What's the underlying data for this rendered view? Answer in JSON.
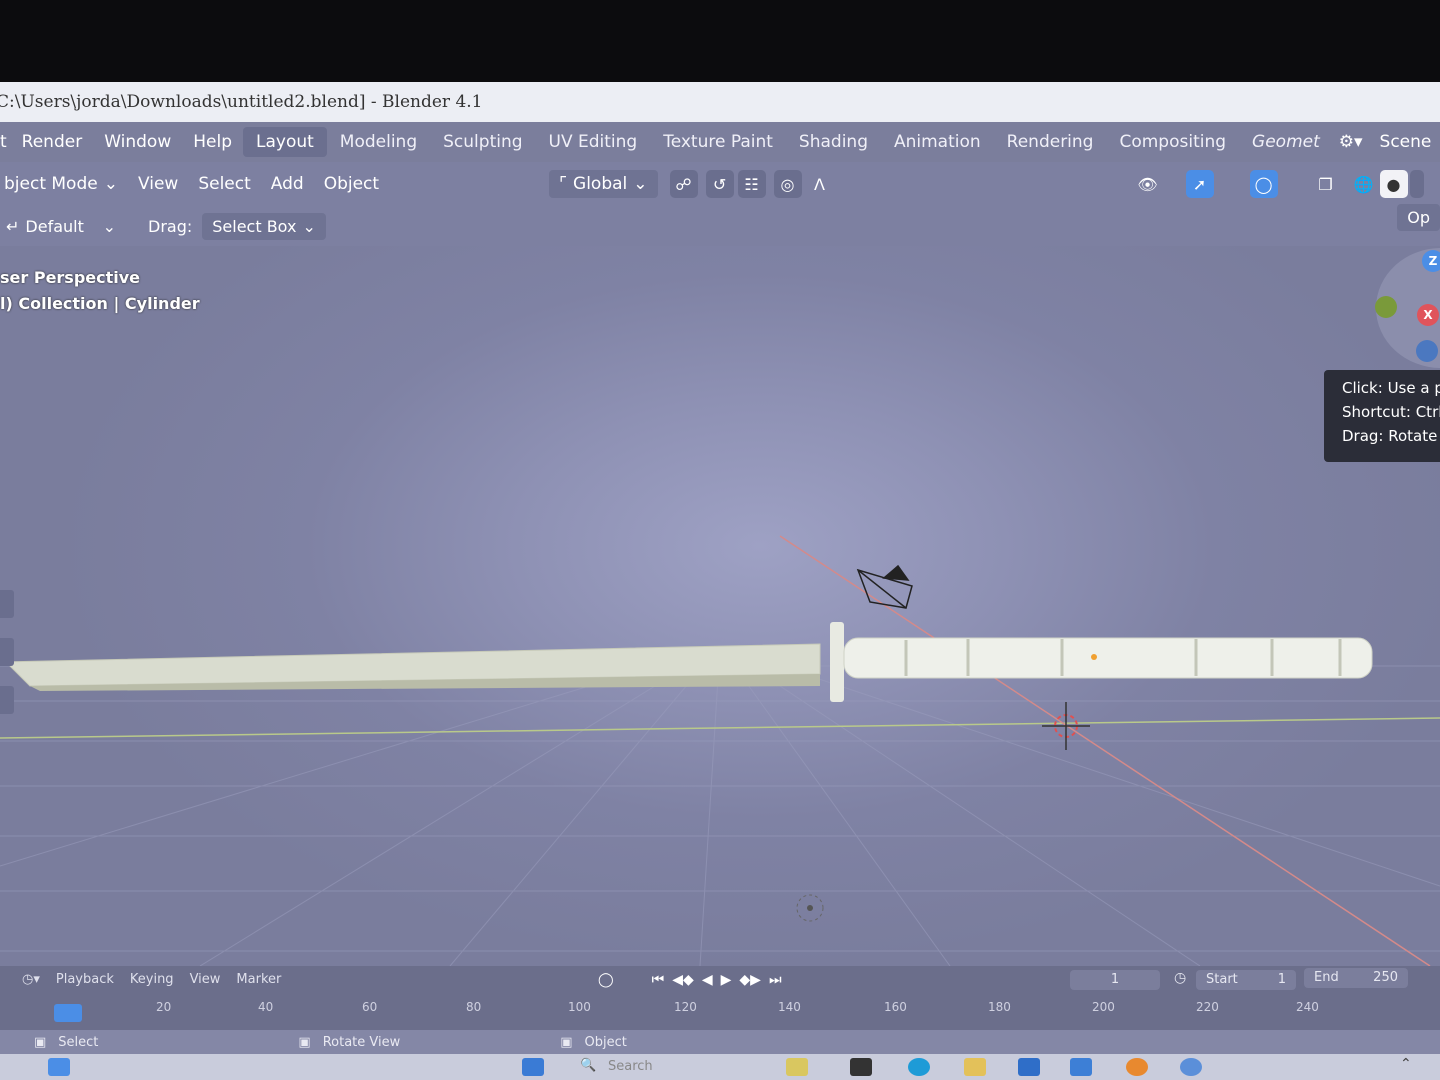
{
  "window": {
    "title": "C:\\Users\\jorda\\Downloads\\untitled2.blend] - Blender 4.1"
  },
  "menu": {
    "items": [
      "Render",
      "Window",
      "Help"
    ],
    "partial_first": "t"
  },
  "workspaces": [
    {
      "label": "Layout",
      "active": true
    },
    {
      "label": "Modeling"
    },
    {
      "label": "Sculpting"
    },
    {
      "label": "UV Editing"
    },
    {
      "label": "Texture Paint"
    },
    {
      "label": "Shading"
    },
    {
      "label": "Animation"
    },
    {
      "label": "Rendering"
    },
    {
      "label": "Compositing"
    },
    {
      "label": "Geomet"
    }
  ],
  "scene": {
    "label": "Scene"
  },
  "header": {
    "mode": "bject Mode",
    "view": "View",
    "select": "Select",
    "add": "Add",
    "object": "Object",
    "orientation": "Global",
    "options_label": "Op"
  },
  "tool_settings": {
    "orientation": "Default",
    "drag_label": "Drag:",
    "drag_value": "Select Box"
  },
  "viewport": {
    "perspective": "ser Perspective",
    "collection": "l) Collection | Cylinder"
  },
  "gizmo": {
    "z": "Z",
    "x": "X"
  },
  "tooltip": {
    "line1": "Click: Use a p",
    "line2": "Shortcut: Ctrl",
    "line3": "Drag: Rotate t"
  },
  "timeline": {
    "playback": "Playback",
    "keying": "Keying",
    "view": "View",
    "marker": "Marker",
    "current_frame": "1",
    "start_label": "Start",
    "start_value": "1",
    "end_label": "End",
    "end_value": "250",
    "ticks": [
      "20",
      "40",
      "60",
      "80",
      "100",
      "120",
      "140",
      "160",
      "180",
      "200",
      "220",
      "240"
    ]
  },
  "status": {
    "select": "Select",
    "rotate": "Rotate View",
    "object": "Object"
  },
  "taskbar": {
    "search": "Search"
  },
  "colors": {
    "viewport_bg": "#8e91b4",
    "accent_blue": "#4b8ee6",
    "axis_x": "#e0545b",
    "axis_y": "#7a9a3a",
    "axis_z": "#4b8ee6"
  }
}
